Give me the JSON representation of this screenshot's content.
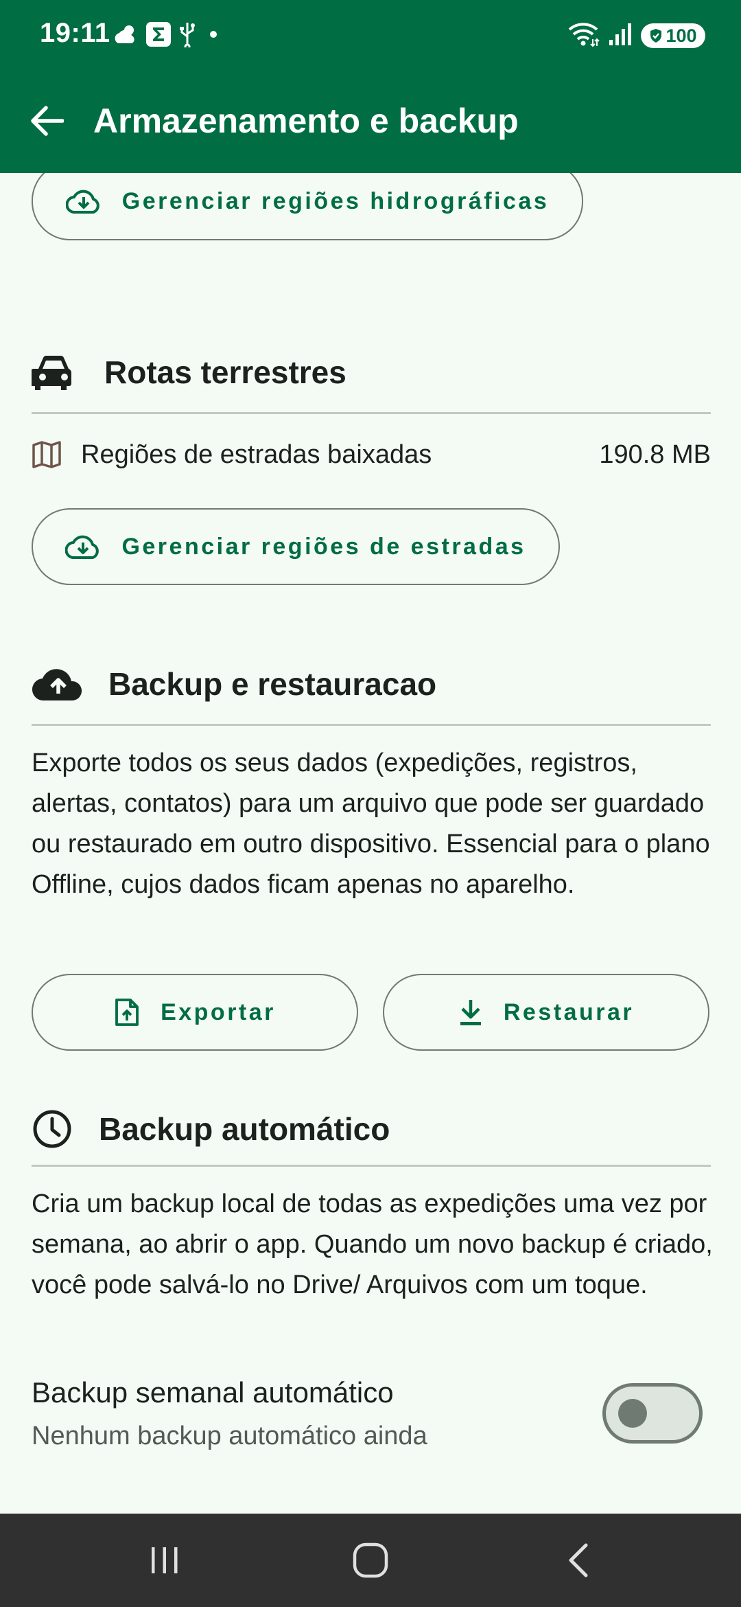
{
  "status_bar": {
    "time": "19:11",
    "battery": "100",
    "icons_left": [
      "weather-icon",
      "sigma-app-icon",
      "usb-icon",
      "dot-icon"
    ],
    "icons_right": [
      "wifi-icon",
      "signal-icon",
      "battery-icon"
    ]
  },
  "app_bar": {
    "title": "Armazenamento e backup",
    "back_icon": "arrow-back-icon"
  },
  "hydro": {
    "manage_button": "Gerenciar regiões hidrográficas"
  },
  "roads": {
    "title": "Rotas terrestres",
    "downloaded_label": "Regiões de estradas baixadas",
    "downloaded_value": "190.8 MB",
    "manage_button": "Gerenciar regiões de estradas"
  },
  "backup": {
    "title": "Backup e restauracao",
    "description": "Exporte todos os seus dados (expedições, registros, alertas, contatos) para um arquivo que pode ser guardado ou restaurado em outro dispositivo. Essencial para o plano Offline, cujos dados ficam apenas no aparelho.",
    "export_button": "Exportar",
    "restore_button": "Restaurar"
  },
  "auto_backup": {
    "title": "Backup automático",
    "description": "Cria um backup local de todas as expedições uma vez por semana, ao abrir o app. Quando um novo backup é criado, você pode salvá-lo no Drive/ Arquivos com um toque.",
    "toggle_label": "Backup semanal automático",
    "toggle_status": "Nenhum backup automático ainda",
    "toggle_on": false
  },
  "colors": {
    "primary": "#006d43",
    "background": "#f4faf4",
    "outline": "#6f7a72",
    "navbar": "#303030"
  }
}
